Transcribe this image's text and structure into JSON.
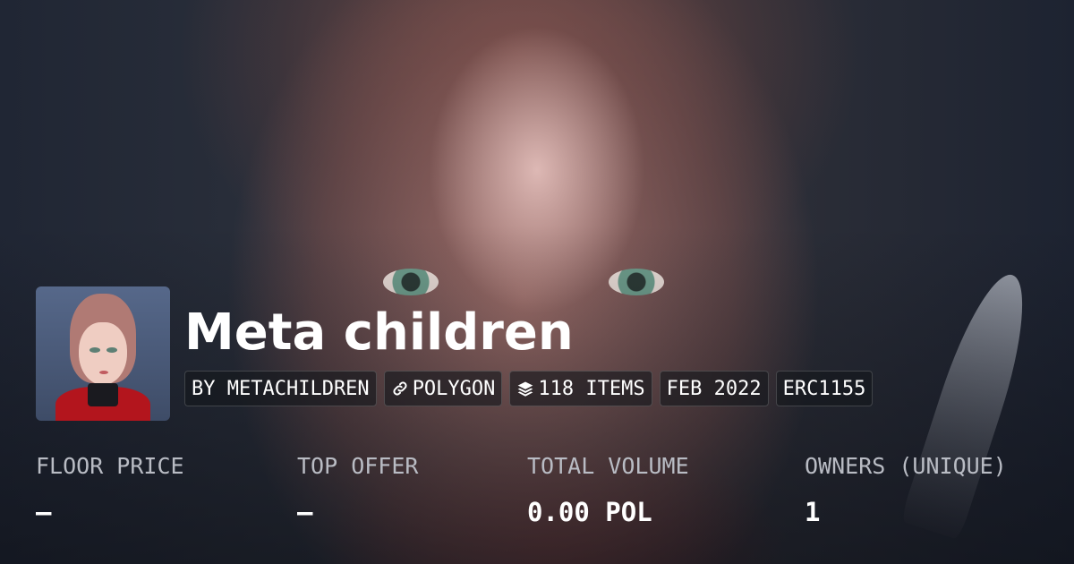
{
  "collection": {
    "name": "Meta children",
    "avatar_alt": "Meta children avatar"
  },
  "tags": [
    {
      "label": "BY METACHILDREN",
      "icon": ""
    },
    {
      "label": "POLYGON",
      "icon": "chain-link-icon"
    },
    {
      "label": "118 ITEMS",
      "icon": "layers-icon"
    },
    {
      "label": "FEB 2022",
      "icon": ""
    },
    {
      "label": "ERC1155",
      "icon": ""
    }
  ],
  "stats": [
    {
      "label": "FLOOR PRICE",
      "value": "—"
    },
    {
      "label": "TOP OFFER",
      "value": "—"
    },
    {
      "label": "TOTAL VOLUME",
      "value": "0.00 POL"
    },
    {
      "label": "OWNERS (UNIQUE)",
      "value": "1"
    }
  ],
  "colors": {
    "background": "#1a1f29",
    "text": "#ffffff",
    "muted_label": "#b9bcc4"
  }
}
